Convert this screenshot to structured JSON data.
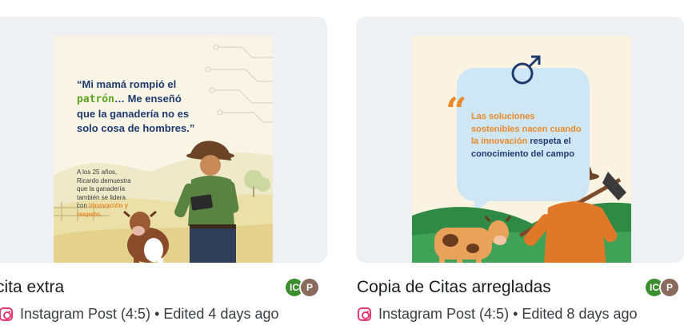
{
  "cards": [
    {
      "title": "cita extra",
      "type_label": "Instagram Post (4:5)",
      "separator": "•",
      "edited": "Edited 4 days ago",
      "avatars": [
        "IC",
        "P"
      ],
      "thumbnail": {
        "quote_part1": "“Mi mamá rompió el",
        "quote_highlight": "patrón",
        "quote_part2": "… Me enseñó que la ganadería no es solo cosa de hombres.”",
        "sub_part1": "A los 25 años, Ricardo demuestra que la ganadería también se lidera con",
        "sub_highlight": "innovación y respeto",
        "sub_end": "."
      }
    },
    {
      "title": "Copia de Citas arregladas",
      "type_label": "Instagram Post (4:5)",
      "separator": "•",
      "edited": "Edited 8 days ago",
      "avatars": [
        "IC",
        "P"
      ],
      "thumbnail": {
        "quote_mark": "“",
        "quote_part1": "Las soluciones sostenibles",
        "quote_or1": "nacen cuando la innovación",
        "quote_part2": "respeta el conocimiento del campo"
      }
    }
  ],
  "colors": {
    "card_bg": "#eef0f3",
    "instagram": "#e23a6e",
    "avatar_ic": "#3c8d2f",
    "avatar_p": "#8a6a5c",
    "accent_orange": "#e88a2a",
    "navy": "#1f3b6e"
  },
  "icons": [
    "instagram-icon",
    "male-symbol-icon",
    "quote-mark-icon"
  ]
}
